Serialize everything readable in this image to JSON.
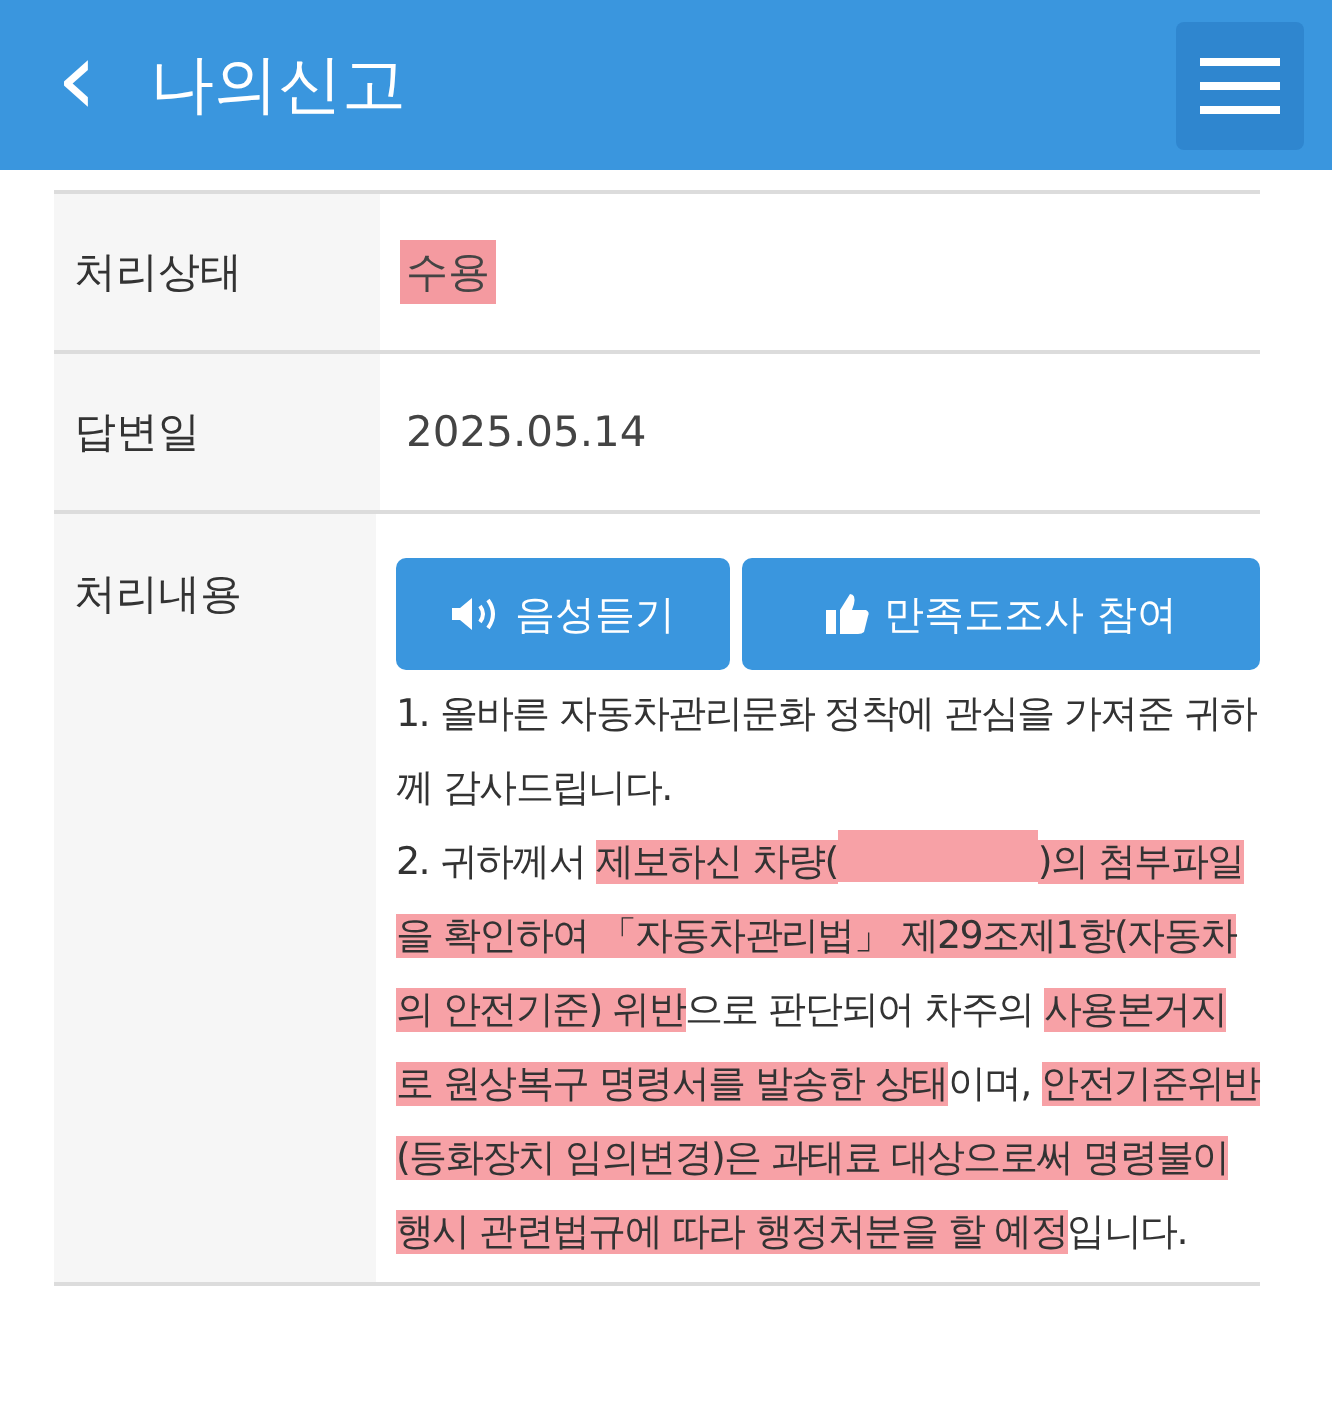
{
  "header": {
    "back_icon": "‹",
    "title": "나의신고"
  },
  "rows": [
    {
      "label": "처리상태",
      "kind": "status",
      "value": "수용",
      "highlighted": true
    },
    {
      "label": "답변일",
      "kind": "text",
      "value": "2025.05.14"
    },
    {
      "label": "처리내용",
      "kind": "answer",
      "buttons": [
        {
          "label": "음성듣기",
          "kind": "listen"
        },
        {
          "label": "만족도조사 참여",
          "kind": "survey"
        }
      ],
      "segments": [
        {
          "kind": "text",
          "text": "1. 올바른 자동차관리문화 정착에 관심을 가져준 귀하께 감사드립니다.",
          "highlighted": false
        },
        {
          "kind": "break"
        },
        {
          "kind": "text",
          "text": "2. 귀하께서 ",
          "highlighted": false
        },
        {
          "kind": "text",
          "text": "제보하신 차량(",
          "highlighted": true
        },
        {
          "kind": "redacted",
          "highlighted": true
        },
        {
          "kind": "text",
          "text": ")의 첨부파일을 확인하여 「자동차관리법」 제29조제1항(자동차의 안전기준) 위반",
          "highlighted": true
        },
        {
          "kind": "text",
          "text": "으로 판단되어 차주의 ",
          "highlighted": false
        },
        {
          "kind": "text",
          "text": "사용본거지로 원상복구 명령서를 발송한 상태",
          "highlighted": true
        },
        {
          "kind": "text",
          "text": "이며, ",
          "highlighted": false
        },
        {
          "kind": "text",
          "text": "안전기준위반(등화장치 임의변경)은 과태료 대상으로써 명령불이행시 관련법규에 따라 행정처분을 할 예정",
          "highlighted": true
        },
        {
          "kind": "text",
          "text": "입니다.",
          "highlighted": false
        }
      ]
    }
  ]
}
